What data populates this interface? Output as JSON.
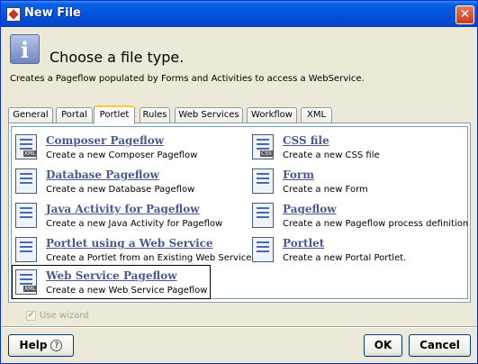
{
  "window": {
    "title": "New File",
    "close_glyph": "✕"
  },
  "header": {
    "info_glyph": "i",
    "heading": "Choose a file type.",
    "description": "Creates a Pageflow populated by Forms and Activities to access a WebService."
  },
  "tabs": [
    "General",
    "Portal",
    "Portlet",
    "Rules",
    "Web Services",
    "Workflow",
    "XML"
  ],
  "active_tab": "Portlet",
  "items": [
    {
      "title": "Composer Pageflow",
      "desc": "Create a new Composer Pageflow",
      "icon": "xml-document-icon",
      "tag": "XML"
    },
    {
      "title": "CSS file",
      "desc": "Create a new CSS file",
      "icon": "css-file-icon",
      "tag": "CSS"
    },
    {
      "title": "Database Pageflow",
      "desc": "Create a new Database Pageflow",
      "icon": "database-pageflow-icon",
      "tag": ""
    },
    {
      "title": "Form",
      "desc": "Create a new Form",
      "icon": "form-icon",
      "tag": ""
    },
    {
      "title": "Java Activity for Pageflow",
      "desc": "Create a new Java Activity for Pageflow",
      "icon": "java-activity-icon",
      "tag": ""
    },
    {
      "title": "Pageflow",
      "desc": "Create a new Pageflow process definition",
      "icon": "pageflow-icon",
      "tag": ""
    },
    {
      "title": "Portlet using a Web Service",
      "desc": "Create a Portlet from an Existing Web Service.",
      "icon": "portlet-web-service-icon",
      "tag": ""
    },
    {
      "title": "Portlet",
      "desc": "Create a new Portal Portlet.",
      "icon": "portlet-icon",
      "tag": ""
    },
    {
      "title": "Web Service Pageflow",
      "desc": "Create a new Web Service Pageflow",
      "icon": "xml-document-icon",
      "tag": "XML"
    }
  ],
  "selected_item": "Web Service Pageflow",
  "wizard": {
    "label": "Use wizard",
    "checked": true,
    "enabled": false,
    "check_glyph": "✔"
  },
  "buttons": {
    "help": "Help",
    "help_glyph": "?",
    "ok": "OK",
    "cancel": "Cancel"
  }
}
